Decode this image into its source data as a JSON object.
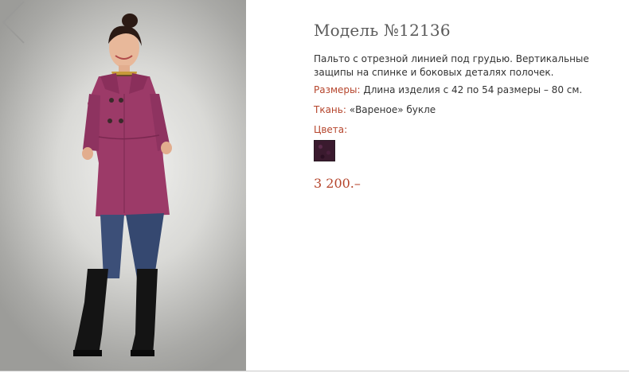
{
  "product": {
    "title": "Модель №12136",
    "description": "Пальто с отрезной линией под грудью. Вертикальные защипы  на спинке и боковых деталях полочек.",
    "sizes_label": "Размеры:",
    "sizes_value": "Длина изделия с 42 по 54 размеры – 80 см.",
    "fabric_label": "Ткань:",
    "fabric_value": "«Вареное» букле",
    "colors_label": "Цвета:",
    "price": "3 200.–"
  },
  "colors": {
    "accent": "#b5452c",
    "title": "#5a5a5a",
    "swatch": "#3a1a2e",
    "coat": "#9c3a68"
  },
  "icons": {
    "prev": "chevron-left-icon"
  }
}
